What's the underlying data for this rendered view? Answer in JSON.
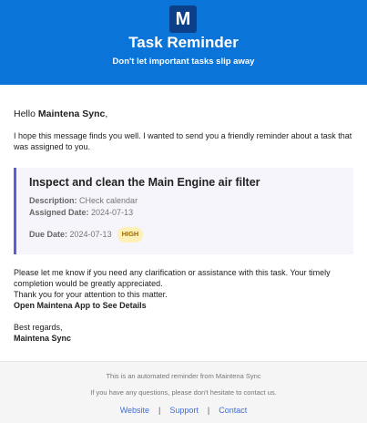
{
  "header": {
    "logo_letter": "M",
    "title": "Task Reminder",
    "subtitle": "Don't let important tasks slip away"
  },
  "content": {
    "greeting_prefix": "Hello ",
    "recipient": "Maintena Sync",
    "greeting_suffix": ",",
    "intro": "I hope this message finds you well. I wanted to send you a friendly reminder about a task that was assigned to you.",
    "task": {
      "title": "Inspect and clean the Main Engine air filter",
      "description_label": "Description:",
      "description_value": "CHeck calendar",
      "assigned_label": "Assigned Date:",
      "assigned_value": "2024-07-13",
      "due_label": "Due Date:",
      "due_value": "2024-07-13",
      "priority": "HIGH"
    },
    "body_line1": "Please let me know if you need any clarification or assistance with this task. Your timely completion would be greatly appreciated.",
    "body_line2": "Thank you for your attention to this matter.",
    "cta": "Open Maintena App to See Details",
    "sign_off": "Best regards,",
    "signature": "Maintena Sync"
  },
  "footer": {
    "line1": "This is an automated reminder from Maintena Sync",
    "line2": "If you have any questions, please don't hesitate to contact us.",
    "links": [
      "Website",
      "Support",
      "Contact"
    ],
    "separator": "|"
  },
  "colors": {
    "header_bg": "#0a74d8",
    "accent_border": "#5a5fd8",
    "badge_bg": "#fff0b8",
    "link": "#3f6fd8"
  }
}
